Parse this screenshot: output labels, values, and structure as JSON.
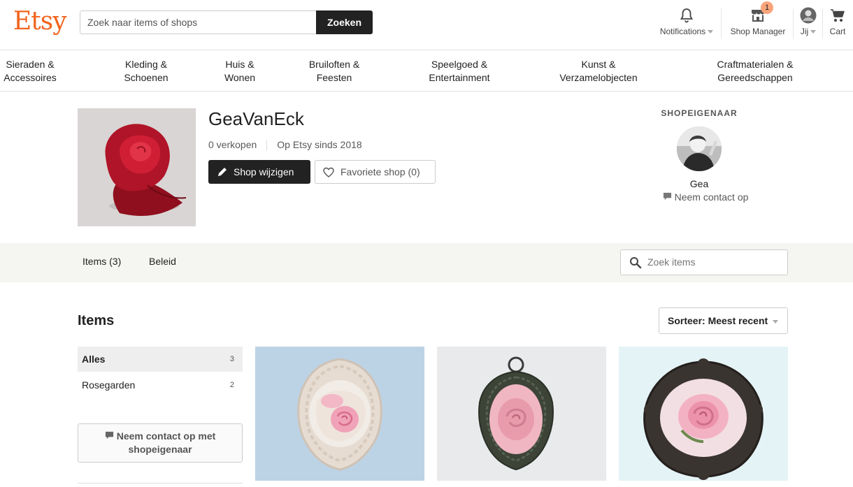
{
  "header": {
    "logo": "Etsy",
    "search_placeholder": "Zoek naar items of shops",
    "search_button": "Zoeken",
    "notifications_label": "Notifications",
    "shop_manager_label": "Shop Manager",
    "shop_manager_badge": "1",
    "you_label": "Jij",
    "cart_label": "Cart"
  },
  "categories": [
    [
      "Sieraden &",
      "Accessoires"
    ],
    [
      "Kleding &",
      "Schoenen"
    ],
    [
      "Huis &",
      "Wonen"
    ],
    [
      "Bruiloften &",
      "Feesten"
    ],
    [
      "Speelgoed &",
      "Entertainment"
    ],
    [
      "Kunst &",
      "Verzamelobjecten"
    ],
    [
      "Craftmaterialen &",
      "Gereedschappen"
    ]
  ],
  "shop": {
    "name": "GeaVanEck",
    "sales": "0 verkopen",
    "since": "Op Etsy sinds 2018",
    "edit_button": "Shop wijzigen",
    "favorite_button": "Favoriete shop (0)"
  },
  "owner": {
    "title": "SHOPEIGENAAR",
    "name": "Gea",
    "contact": "Neem contact op"
  },
  "tabs": {
    "items": "Items (3)",
    "policy": "Beleid",
    "search_placeholder": "Zoek items"
  },
  "items_section": {
    "title": "Items",
    "sort": "Sorteer: Meest recent",
    "sections": [
      {
        "label": "Alles",
        "count": "3"
      },
      {
        "label": "Rosegarden",
        "count": "2"
      }
    ],
    "contact_button": [
      "Neem contact op met",
      "shopeigenaar"
    ]
  },
  "colors": {
    "brand": "#F1641E",
    "dark_button": "#222222",
    "tab_bar_bg": "#F5F5F1"
  }
}
